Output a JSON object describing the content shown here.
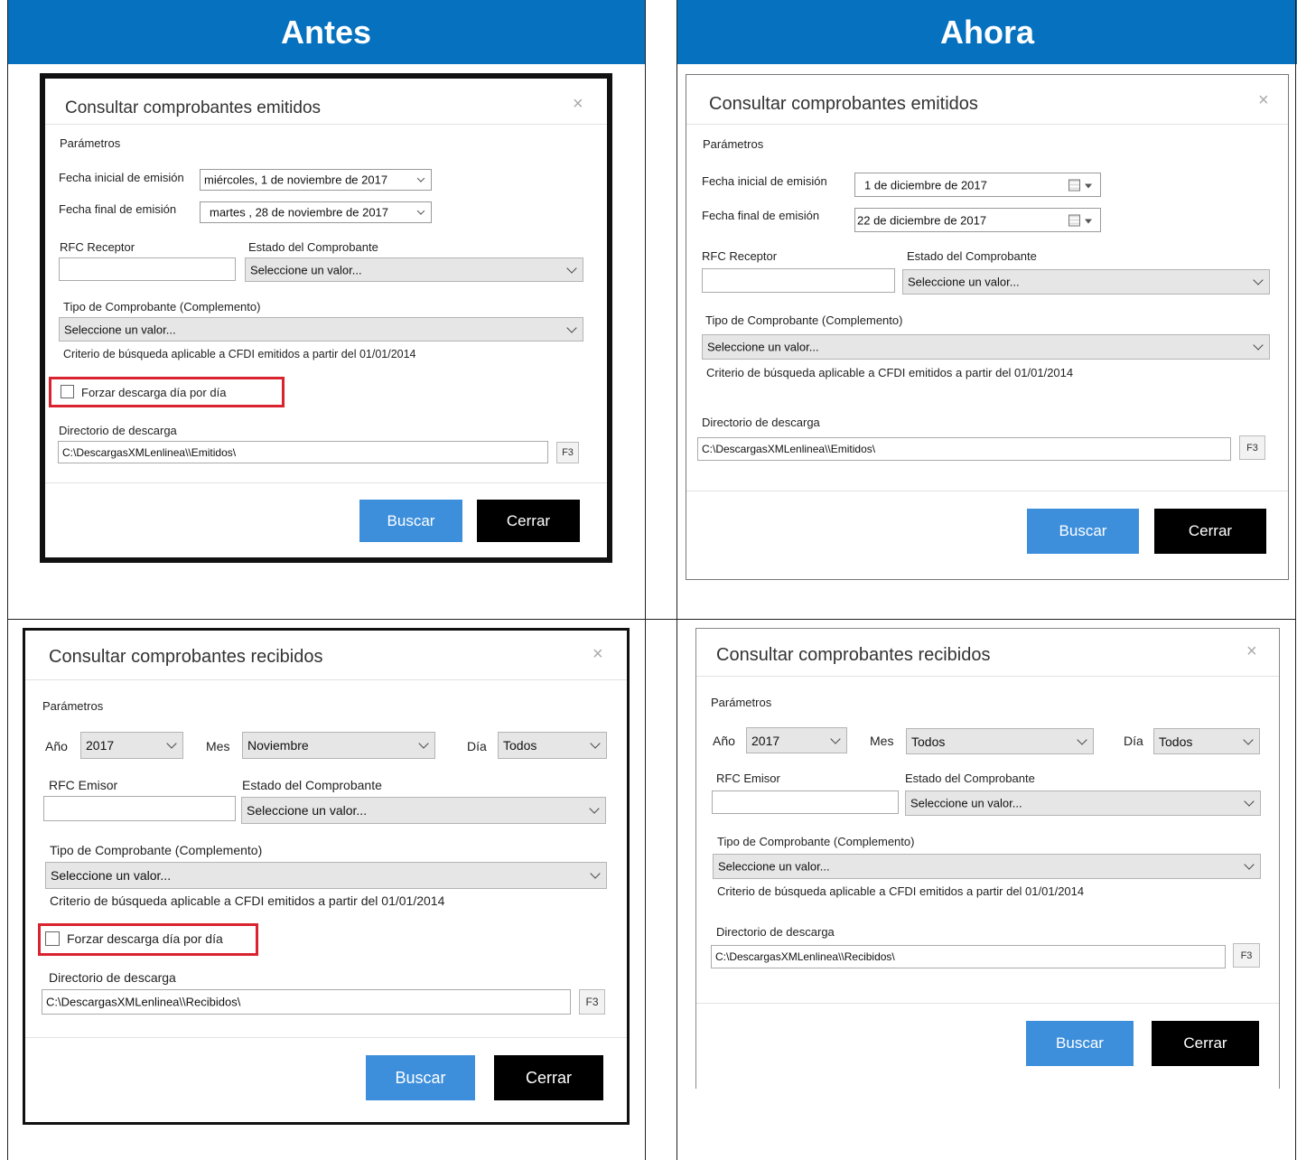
{
  "headers": {
    "before": "Antes",
    "now": "Ahora"
  },
  "emitidos": {
    "title": "Consultar comprobantes emitidos",
    "params": "Parámetros",
    "fecha_inicial_label": "Fecha inicial de emisión",
    "fecha_final_label": "Fecha final de emisión",
    "fecha_inicial_antes": "miércoles,   1 de noviembre  de 2017",
    "fecha_final_antes": "martes   , 28 de noviembre  de 2017",
    "fecha_inicial_ahora": "1 de  diciembre   de 2017",
    "fecha_final_ahora": "22 de  diciembre   de 2017",
    "rfc_label": "RFC Receptor",
    "estado_label": "Estado del Comprobante",
    "estado_value": "Seleccione un valor...",
    "tipo_label": "Tipo de Comprobante (Complemento)",
    "tipo_value": "Seleccione un valor...",
    "criterio": "Criterio de búsqueda aplicable a CFDI emitidos a partir del 01/01/2014",
    "forzar": "Forzar descarga día por día",
    "dir_label": "Directorio de descarga",
    "dir_value": "C:\\DescargasXMLenlinea\\\\Emitidos\\",
    "f3": "F3",
    "buscar": "Buscar",
    "cerrar": "Cerrar",
    "close_glyph": "×"
  },
  "recibidos": {
    "title": "Consultar comprobantes recibidos",
    "params": "Parámetros",
    "anio_label": "Año",
    "anio_value": "2017",
    "mes_label": "Mes",
    "mes_antes": "Noviembre",
    "mes_ahora": "Todos",
    "dia_label": "Día",
    "dia_value": "Todos",
    "rfc_label": "RFC Emisor",
    "estado_label": "Estado del Comprobante",
    "estado_value": "Seleccione un valor...",
    "tipo_label": "Tipo de Comprobante (Complemento)",
    "tipo_value": "Seleccione un valor...",
    "criterio": "Criterio de búsqueda aplicable a CFDI emitidos a partir del 01/01/2014",
    "forzar": "Forzar descarga día por día",
    "dir_label": "Directorio de descarga",
    "dir_value": "C:\\DescargasXMLenlinea\\\\Recibidos\\",
    "f3": "F3",
    "buscar": "Buscar",
    "cerrar": "Cerrar",
    "close_glyph": "×"
  },
  "colors": {
    "header_blue": "#0671bf",
    "button_blue": "#3d8fdc",
    "highlight_red": "#d9232f"
  }
}
